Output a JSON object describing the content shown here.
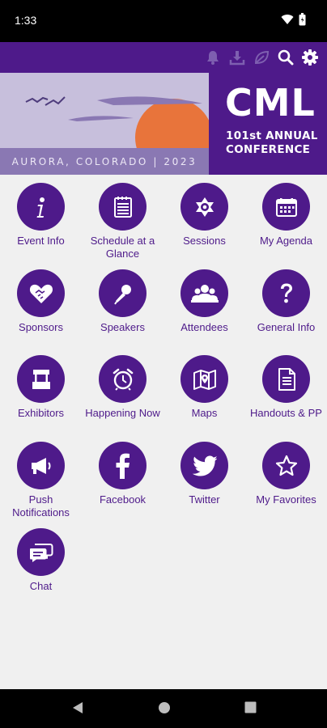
{
  "status_bar": {
    "time": "1:33"
  },
  "banner": {
    "location": "AURORA, COLORADO | 2023",
    "brand": "CML",
    "subtitle_line1": "101st ANNUAL",
    "subtitle_line2": "CONFERENCE"
  },
  "menu": [
    {
      "label": "Event Info",
      "icon": "info-icon"
    },
    {
      "label": "Schedule at a Glance",
      "icon": "schedule-icon"
    },
    {
      "label": "Sessions",
      "icon": "sessions-icon"
    },
    {
      "label": "My Agenda",
      "icon": "calendar-icon"
    },
    {
      "label": "Sponsors",
      "icon": "handshake-heart-icon"
    },
    {
      "label": "Speakers",
      "icon": "microphone-icon"
    },
    {
      "label": "Attendees",
      "icon": "people-icon"
    },
    {
      "label": "General Info",
      "icon": "question-icon"
    },
    {
      "label": "Exhibitors",
      "icon": "booth-icon"
    },
    {
      "label": "Happening Now",
      "icon": "alarm-clock-icon"
    },
    {
      "label": "Maps",
      "icon": "map-icon"
    },
    {
      "label": "Handouts & PP",
      "icon": "document-icon"
    },
    {
      "label": "Push Notifications",
      "icon": "megaphone-icon"
    },
    {
      "label": "Facebook",
      "icon": "facebook-icon"
    },
    {
      "label": "Twitter",
      "icon": "twitter-icon"
    },
    {
      "label": "My Favorites",
      "icon": "star-icon"
    },
    {
      "label": "Chat",
      "icon": "chat-icon"
    }
  ],
  "colors": {
    "primary": "#4e1a8a",
    "background": "#f0f0f0",
    "sun": "#e8743b",
    "banner_sky": "#c7bfdc"
  }
}
